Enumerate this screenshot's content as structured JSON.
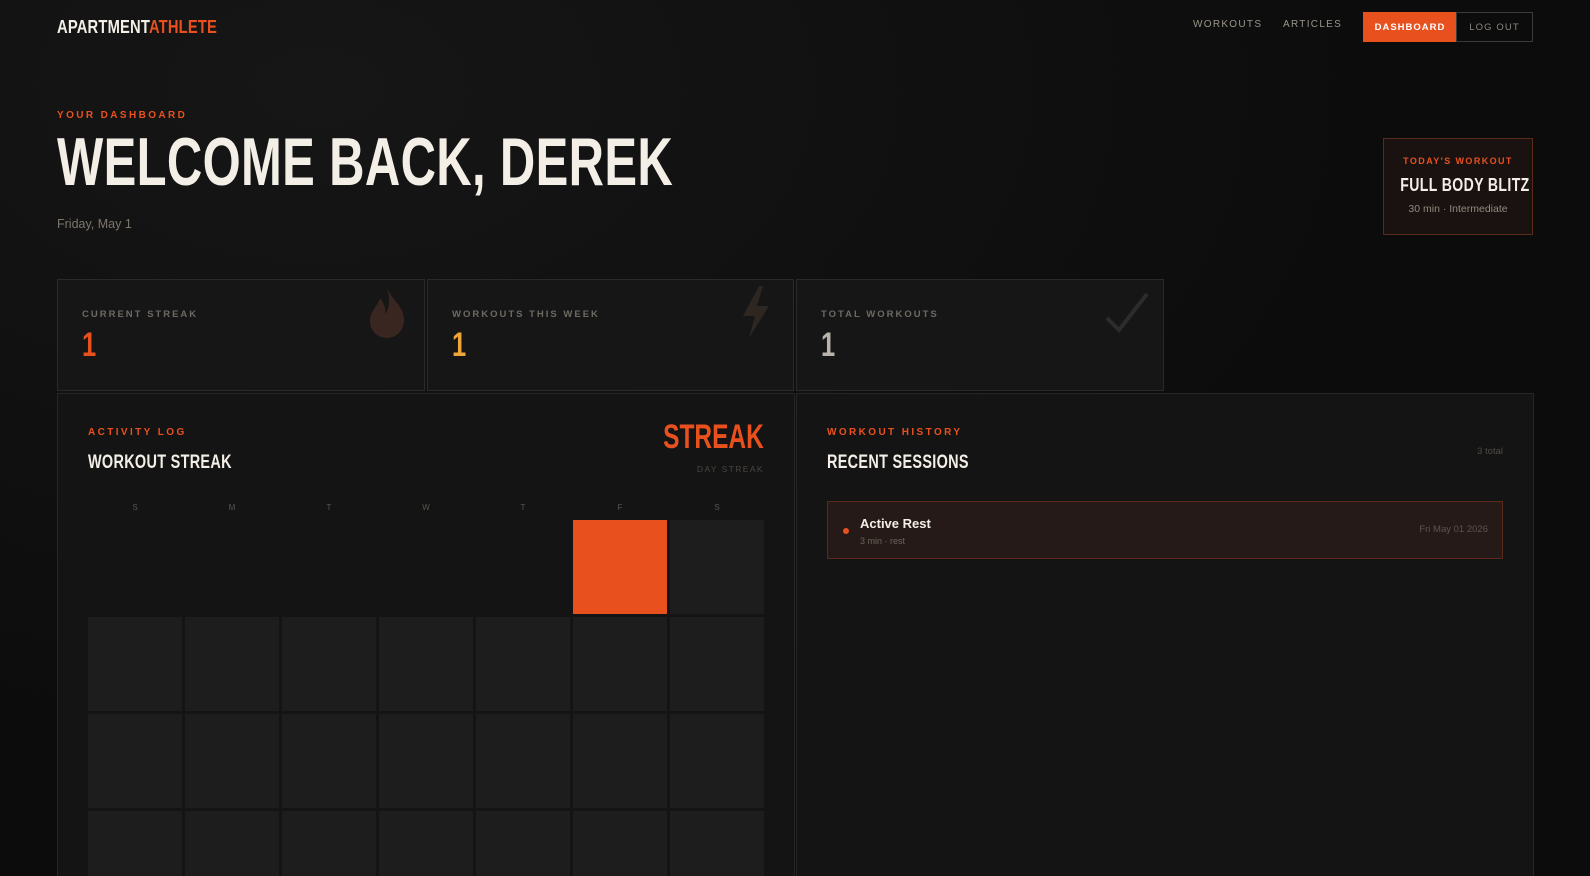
{
  "nav": {
    "logo_part1": "APARTMENT",
    "logo_part2": "ATHLETE",
    "links": [
      "WORKOUTS",
      "ARTICLES"
    ],
    "dashboard_label": "DASHBOARD",
    "logout_label": "LOG OUT"
  },
  "hero": {
    "eyebrow": "YOUR DASHBOARD",
    "title": "WELCOME BACK, DEREK",
    "date": "Friday, May 1"
  },
  "today": {
    "eyebrow": "TODAY'S WORKOUT",
    "name": "FULL BODY BLITZ",
    "meta": "30 min · Intermediate"
  },
  "stats": [
    {
      "label": "CURRENT STREAK",
      "value": "1",
      "color": "#e8511e",
      "icon": "flame-icon"
    },
    {
      "label": "WORKOUTS THIS WEEK",
      "value": "1",
      "color": "#f0a53a",
      "icon": "lightning-icon"
    },
    {
      "label": "TOTAL WORKOUTS",
      "value": "1",
      "color": "#b9b4ab",
      "icon": "checkmark-icon"
    }
  ],
  "activity": {
    "eyebrow": "ACTIVITY LOG",
    "title": "WORKOUT STREAK",
    "streak_big": "STREAK",
    "streak_sub": "DAY STREAK",
    "days": [
      "S",
      "M",
      "T",
      "W",
      "T",
      "F",
      "S"
    ]
  },
  "history": {
    "eyebrow": "WORKOUT HISTORY",
    "title": "RECENT SESSIONS",
    "count": "3 total",
    "sessions": [
      {
        "name": "Active Rest",
        "meta": "3 min · rest",
        "date": "Fri May 01 2026"
      }
    ]
  },
  "colors": {
    "accent": "#e8511e",
    "background": "#0c0c0c"
  }
}
